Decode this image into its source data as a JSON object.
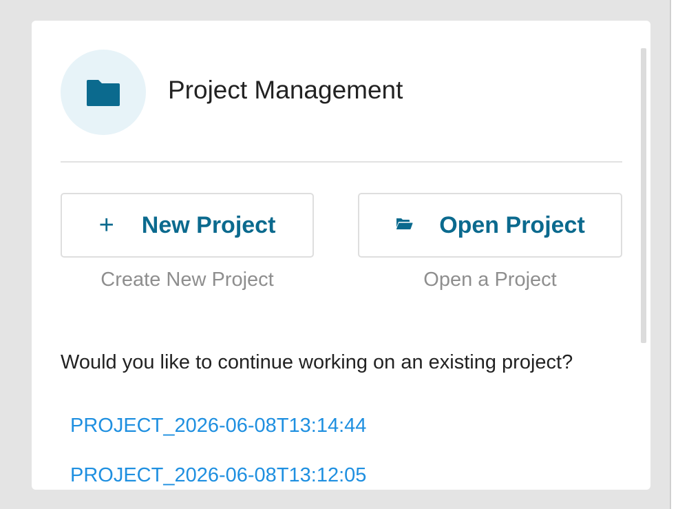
{
  "header": {
    "title": "Project Management",
    "icon": "folder-icon"
  },
  "actions": {
    "new_project": {
      "label": "New Project",
      "subtitle": "Create New Project",
      "icon": "plus-icon"
    },
    "open_project": {
      "label": "Open Project",
      "subtitle": "Open a Project",
      "icon": "folder-open-icon"
    }
  },
  "recent": {
    "prompt": "Would you like to continue working on an existing project?",
    "projects": [
      {
        "name": "PROJECT_2026-06-08T13:14:44"
      },
      {
        "name": "PROJECT_2026-06-08T13:12:05"
      }
    ]
  },
  "colors": {
    "accent": "#0b6a8e",
    "link": "#1e8fe0",
    "icon_circle_bg": "#e7f3f8",
    "frame_bg": "#e4e4e4"
  }
}
